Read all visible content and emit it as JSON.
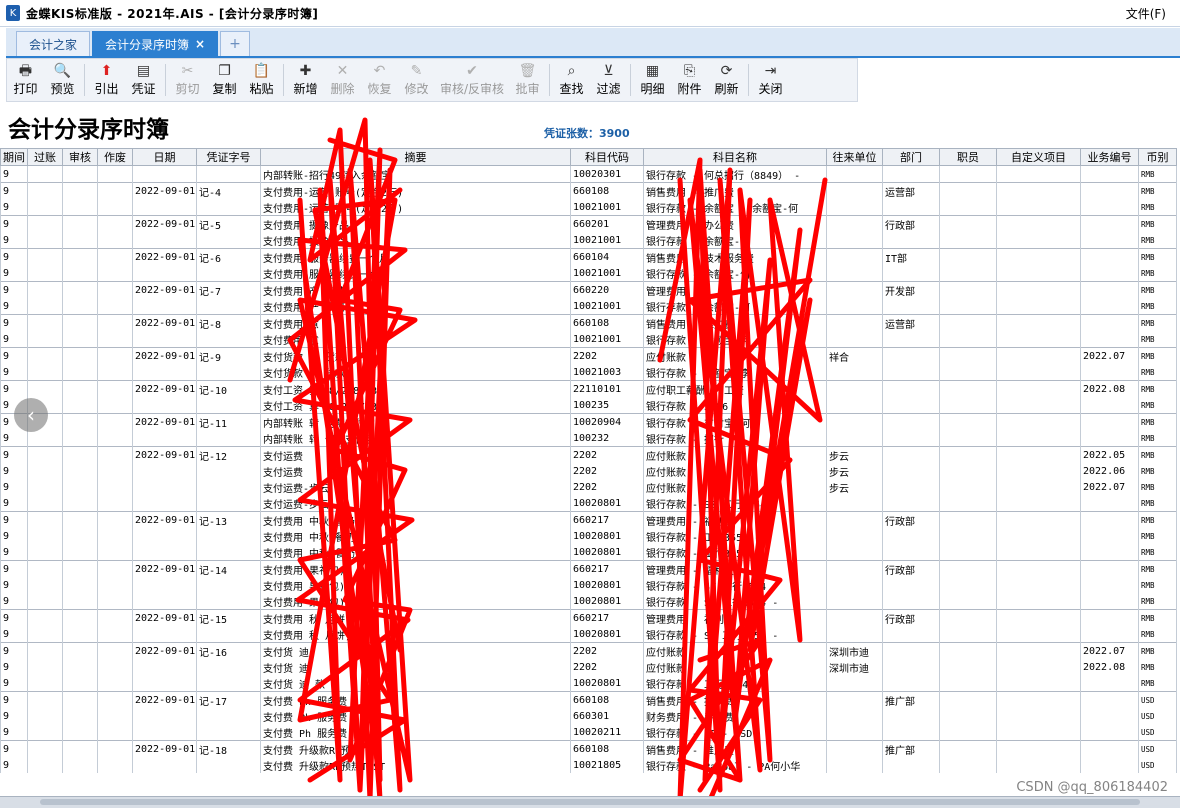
{
  "window": {
    "title": "金蝶KIS标准版 - 2021年.AIS - [会计分录序时簿]",
    "menu_file": "文件(F)"
  },
  "tabs": [
    {
      "label": "会计之家",
      "active": false
    },
    {
      "label": "会计分录序时簿",
      "active": true
    }
  ],
  "tab_close_glyph": "×",
  "tab_add_glyph": "+",
  "toolbar": [
    {
      "label": "打印",
      "icon": "printer-icon",
      "glyph": "🖶",
      "enabled": true
    },
    {
      "label": "预览",
      "icon": "preview-icon",
      "glyph": "🔍",
      "enabled": true
    },
    {
      "sep": true
    },
    {
      "label": "引出",
      "icon": "export-icon",
      "glyph": "⬆",
      "enabled": true,
      "red": true
    },
    {
      "label": "凭证",
      "icon": "voucher-icon",
      "glyph": "▤",
      "enabled": true
    },
    {
      "sep": true
    },
    {
      "label": "剪切",
      "icon": "scissors-icon",
      "glyph": "✂",
      "enabled": false
    },
    {
      "label": "复制",
      "icon": "copy-icon",
      "glyph": "❐",
      "enabled": true
    },
    {
      "label": "粘贴",
      "icon": "paste-icon",
      "glyph": "📋",
      "enabled": true
    },
    {
      "sep": true
    },
    {
      "label": "新增",
      "icon": "new-icon",
      "glyph": "✚",
      "enabled": true
    },
    {
      "label": "删除",
      "icon": "delete-icon",
      "glyph": "✕",
      "enabled": false
    },
    {
      "label": "恢复",
      "icon": "undo-icon",
      "glyph": "↶",
      "enabled": false
    },
    {
      "label": "修改",
      "icon": "edit-icon",
      "glyph": "✎",
      "enabled": false
    },
    {
      "label": "审核/反审核",
      "icon": "audit-icon",
      "glyph": "✔",
      "enabled": false,
      "wide": true
    },
    {
      "label": "批审",
      "icon": "batch-audit-icon",
      "glyph": "🗑",
      "enabled": false
    },
    {
      "sep": true
    },
    {
      "label": "查找",
      "icon": "binoculars-icon",
      "glyph": "⌕",
      "enabled": true
    },
    {
      "label": "过滤",
      "icon": "filter-icon",
      "glyph": "⊻",
      "enabled": true
    },
    {
      "sep": true
    },
    {
      "label": "明细",
      "icon": "detail-icon",
      "glyph": "▦",
      "enabled": true
    },
    {
      "label": "附件",
      "icon": "attachment-icon",
      "glyph": "⎘",
      "enabled": true
    },
    {
      "label": "刷新",
      "icon": "refresh-icon",
      "glyph": "⟳",
      "enabled": true
    },
    {
      "sep": true
    },
    {
      "label": "关闭",
      "icon": "exit-icon",
      "glyph": "⇥",
      "enabled": true
    }
  ],
  "report": {
    "title": "会计分录序时簿",
    "voucher_count_label": "凭证张数：3900"
  },
  "columns": [
    "期间",
    "过账",
    "审核",
    "作废",
    "日期",
    "凭证字号",
    "摘要",
    "科目代码",
    "科目名称",
    "往来单位",
    "部门",
    "职员",
    "自定义项目",
    "业务编号",
    "币别"
  ],
  "rows": [
    {
      "period": "9",
      "date": "",
      "vno": "",
      "summary": "内部转账-招行49转入余额宝",
      "code": "10020301",
      "account": "银行存款 - 何总招行（8849） -",
      "partner": "",
      "dept": "",
      "biz": "",
      "cur": "RMB",
      "start": false
    },
    {
      "period": "9",
      "date": "2022-09-01",
      "vno": "记-4",
      "summary": "支付费用-运营 账号(定金2万)",
      "code": "660108",
      "account": "销售费用 - 推广费",
      "partner": "",
      "dept": "运营部",
      "biz": "",
      "cur": "RMB",
      "start": true
    },
    {
      "period": "9",
      "date": "",
      "vno": "",
      "summary": "支付费用-运营 账号(定金2万)",
      "code": "10021001",
      "account": "银行存款 - 余额宝 - 余额宝-何",
      "partner": "",
      "dept": "",
      "biz": "",
      "cur": "RMB",
      "start": false
    },
    {
      "period": "9",
      "date": "2022-09-01",
      "vno": "记-5",
      "summary": "支付费用 摄像产品",
      "code": "660201",
      "account": "管理费用 - 办公费",
      "partner": "",
      "dept": "行政部",
      "biz": "",
      "cur": "RMB",
      "start": true
    },
    {
      "period": "9",
      "date": "",
      "vno": "",
      "summary": "支付费用 摄像产品",
      "code": "10021001",
      "account": "银行存款 - 余额宝-何",
      "partner": "",
      "dept": "",
      "biz": "",
      "cur": "RMB",
      "start": false
    },
    {
      "period": "9",
      "date": "2022-09-01",
      "vno": "记-6",
      "summary": "支付费用 服务器续费一个月",
      "code": "660104",
      "account": "销售费用 - 技术服务费",
      "partner": "",
      "dept": "IT部",
      "biz": "",
      "cur": "RMB",
      "start": true
    },
    {
      "period": "9",
      "date": "",
      "vno": "",
      "summary": "支付费用 服务器续费一个月",
      "code": "10021001",
      "account": "银行存款 - 余额宝-何",
      "partner": "",
      "dept": "",
      "biz": "",
      "cur": "RMB",
      "start": false
    },
    {
      "period": "9",
      "date": "2022-09-01",
      "vno": "记-7",
      "summary": "支付费用 产 申请",
      "code": "660220",
      "account": "管理费用",
      "partner": "",
      "dept": "开发部",
      "biz": "",
      "cur": "RMB",
      "start": true
    },
    {
      "period": "9",
      "date": "",
      "vno": "",
      "summary": "支付费用 产 申请",
      "code": "10021001",
      "account": "银行存款 - 余额宝-何",
      "partner": "",
      "dept": "",
      "biz": "",
      "cur": "RMB",
      "start": false
    },
    {
      "period": "9",
      "date": "2022-09-01",
      "vno": "记-8",
      "summary": "支付费用 意",
      "code": "660108",
      "account": "销售费用 - 推广费",
      "partner": "",
      "dept": "运营部",
      "biz": "",
      "cur": "RMB",
      "start": true
    },
    {
      "period": "9",
      "date": "",
      "vno": "",
      "summary": "支付费用 意",
      "code": "10021001",
      "account": "银行存款 - 余额宝-何",
      "partner": "",
      "dept": "",
      "biz": "",
      "cur": "RMB",
      "start": false
    },
    {
      "period": "9",
      "date": "2022-09-01",
      "vno": "记-9",
      "summary": "支付货款 祥 货款",
      "code": "2202",
      "account": "应付账款",
      "partner": "祥合",
      "dept": "",
      "biz": "2022.07",
      "cur": "RMB",
      "start": true
    },
    {
      "period": "9",
      "date": "",
      "vno": "",
      "summary": "支付货款 祥 货款",
      "code": "10021003",
      "account": "银行存款 - 余额宝-李",
      "partner": "",
      "dept": "",
      "biz": "",
      "cur": "RMB",
      "start": false
    },
    {
      "period": "9",
      "date": "2022-09-01",
      "vno": "记-10",
      "summary": "支付工资 算（8/2-8/13）",
      "code": "22110101",
      "account": "应付职工薪酬 - 工资",
      "partner": "",
      "dept": "",
      "biz": "2022.08",
      "cur": "RMB",
      "start": true
    },
    {
      "period": "9",
      "date": "",
      "vno": "",
      "summary": "支付工资 算（8/2-8/13）",
      "code": "100235",
      "account": "银行存款 - 3396",
      "partner": "",
      "dept": "",
      "biz": "",
      "cur": "RMB",
      "start": false
    },
    {
      "period": "9",
      "date": "2022-09-01",
      "vno": "记-11",
      "summary": "内部转账 转 何彪支付宝",
      "code": "10020904",
      "account": "银行存款 - 支付宝-何",
      "partner": "",
      "dept": "",
      "biz": "",
      "cur": "RMB",
      "start": true
    },
    {
      "period": "9",
      "date": "",
      "vno": "",
      "summary": "内部转账 转 何彪支付宝",
      "code": "100232",
      "account": "银行存款 - 招行",
      "partner": "",
      "dept": "",
      "biz": "",
      "cur": "RMB",
      "start": false
    },
    {
      "period": "9",
      "date": "2022-09-01",
      "vno": "记-12",
      "summary": "支付运费",
      "code": "2202",
      "account": "应付账款",
      "partner": "步云",
      "dept": "",
      "biz": "2022.05",
      "cur": "RMB",
      "start": true
    },
    {
      "period": "9",
      "date": "",
      "vno": "",
      "summary": "支付运费",
      "code": "2202",
      "account": "应付账款",
      "partner": "步云",
      "dept": "",
      "biz": "2022.06",
      "cur": "RMB",
      "start": false
    },
    {
      "period": "9",
      "date": "",
      "vno": "",
      "summary": "支付运费-步云",
      "code": "2202",
      "account": "应付账款",
      "partner": "步云",
      "dept": "",
      "biz": "2022.07",
      "cur": "RMB",
      "start": false
    },
    {
      "period": "9",
      "date": "",
      "vno": "",
      "summary": "支付运费-步云",
      "code": "10020801",
      "account": "银行存款 - SZ 工行3554 -",
      "partner": "",
      "dept": "",
      "biz": "",
      "cur": "RMB",
      "start": false
    },
    {
      "period": "9",
      "date": "2022-09-01",
      "vno": "记-13",
      "summary": "支付费用 中秋 餐奶)",
      "code": "660217",
      "account": "管理费用 - 福利费",
      "partner": "",
      "dept": "行政部",
      "biz": "",
      "cur": "RMB",
      "start": true
    },
    {
      "period": "9",
      "date": "",
      "vno": "",
      "summary": "支付费用 中秋 餐奶)",
      "code": "10020801",
      "account": "银行存款 - 工行3554 -",
      "partner": "",
      "dept": "",
      "biz": "",
      "cur": "RMB",
      "start": false
    },
    {
      "period": "9",
      "date": "",
      "vno": "",
      "summary": "支付费用 中秋 餐奶)",
      "code": "10020801",
      "account": "银行存款 - 工行3554 -",
      "partner": "",
      "dept": "",
      "biz": "",
      "cur": "RMB",
      "start": false
    },
    {
      "period": "9",
      "date": "2022-09-01",
      "vno": "记-14",
      "summary": "支付费用 果礼包)",
      "code": "660217",
      "account": "管理费用 - 福利费",
      "partner": "",
      "dept": "行政部",
      "biz": "",
      "cur": "RMB",
      "start": true
    },
    {
      "period": "9",
      "date": "",
      "vno": "",
      "summary": "支付费用 果礼包)",
      "code": "10020801",
      "account": "银行存款 - SZ 工行3554 -",
      "partner": "",
      "dept": "",
      "biz": "",
      "cur": "RMB",
      "start": false
    },
    {
      "period": "9",
      "date": "",
      "vno": "",
      "summary": "支付费用 果礼包)",
      "code": "10020801",
      "account": "银行存款 - SZ 工行3554 -",
      "partner": "",
      "dept": "",
      "biz": "",
      "cur": "RMB",
      "start": false
    },
    {
      "period": "9",
      "date": "2022-09-01",
      "vno": "记-15",
      "summary": "支付费用 秋 月饼)",
      "code": "660217",
      "account": "管理费用 - 福利费",
      "partner": "",
      "dept": "行政部",
      "biz": "",
      "cur": "RMB",
      "start": true
    },
    {
      "period": "9",
      "date": "",
      "vno": "",
      "summary": "支付费用 秋 月饼)",
      "code": "10020801",
      "account": "银行存款 - SZ 工行3554 -",
      "partner": "",
      "dept": "",
      "biz": "",
      "cur": "RMB",
      "start": false
    },
    {
      "period": "9",
      "date": "2022-09-01",
      "vno": "记-16",
      "summary": "支付货 迪",
      "code": "2202",
      "account": "应付账款",
      "partner": "深圳市迪",
      "dept": "",
      "biz": "2022.07",
      "cur": "RMB",
      "start": true
    },
    {
      "period": "9",
      "date": "",
      "vno": "",
      "summary": "支付货 迪",
      "code": "2202",
      "account": "应付账款",
      "partner": "深圳市迪",
      "dept": "",
      "biz": "2022.08",
      "cur": "RMB",
      "start": false
    },
    {
      "period": "9",
      "date": "",
      "vno": "",
      "summary": "支付货 迪 款",
      "code": "10020801",
      "account": "银行存款 - 工行3554 -",
      "partner": "",
      "dept": "",
      "biz": "",
      "cur": "RMB",
      "start": false
    },
    {
      "period": "9",
      "date": "2022-09-01",
      "vno": "记-17",
      "summary": "支付费 Ph 服务费",
      "code": "660108",
      "account": "销售费用 - 推广费",
      "partner": "",
      "dept": "推广部",
      "biz": "",
      "cur": "USD",
      "start": true
    },
    {
      "period": "9",
      "date": "",
      "vno": "",
      "summary": "支付费 Ph 服务费",
      "code": "660301",
      "account": "财务费用 - 手续费",
      "partner": "",
      "dept": "",
      "biz": "",
      "cur": "USD",
      "start": false
    },
    {
      "period": "9",
      "date": "",
      "vno": "",
      "summary": "支付费 Ph 服务费",
      "code": "10020211",
      "account": "银行存款 - PF - USD",
      "partner": "",
      "dept": "",
      "biz": "",
      "cur": "USD",
      "start": false
    },
    {
      "period": "9",
      "date": "2022-09-01",
      "vno": "记-18",
      "summary": "支付费 升级款RP预热",
      "code": "660108",
      "account": "销售费用 - 推广费",
      "partner": "",
      "dept": "推广部",
      "biz": "",
      "cur": "USD",
      "start": true
    },
    {
      "period": "9",
      "date": "",
      "vno": "",
      "summary": "支付费 升级款RP预热TEST",
      "code": "10021805",
      "account": "银行存款 - Paypal - PA何小华",
      "partner": "",
      "dept": "",
      "biz": "",
      "cur": "USD",
      "start": false
    }
  ],
  "nav_prev_glyph": "‹",
  "watermark": "CSDN @qq_806184402",
  "colors": {
    "scribble": "#ff0000",
    "accent": "#2c7fd0",
    "link": "#1b5fa6"
  }
}
